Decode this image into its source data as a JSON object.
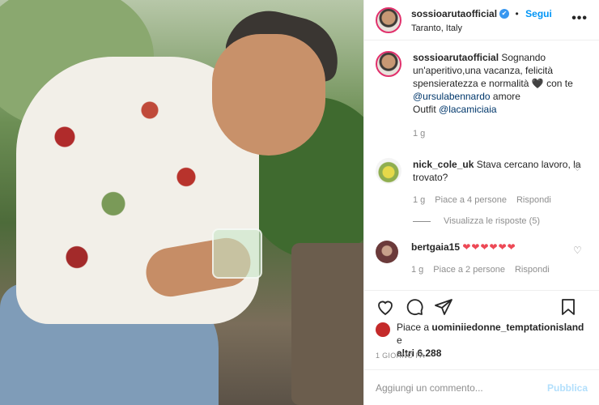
{
  "header": {
    "username": "sossioarutaofficial",
    "verified_mark": "✔",
    "separator": "•",
    "follow_label": "Segui",
    "location": "Taranto, Italy",
    "more_icon": "more-horizontal-icon"
  },
  "caption": {
    "username": "sossioarutaofficial",
    "text_part1": "Sognando un'aperitivo,una vacanza, felicità spensieratezza e normalità",
    "emoji": "🖤",
    "text_part2": "con te",
    "mention1": "@ursulabennardo",
    "text_part3": "amore",
    "outfit_label": "Outfit",
    "mention2": "@lacamiciaia",
    "time": "1 g"
  },
  "comments": [
    {
      "username": "nick_cole_uk",
      "text": "Stava cercano lavoro, la trovato?",
      "time": "1 g",
      "likes": "Piace a 4 persone",
      "reply": "Rispondi",
      "view_replies": "Visualizza le risposte (5)"
    },
    {
      "username": "bertgaia15",
      "text": "❤❤❤❤❤❤",
      "time": "1 g",
      "likes": "Piace a 2 persone",
      "reply": "Rispondi"
    }
  ],
  "likes": {
    "prefix": "Piace a",
    "user": "uominiiedonne_temptationisland",
    "connector": "e",
    "others": "altri 6.288"
  },
  "timestamp": "1 GIORNO FA",
  "add_comment": {
    "placeholder": "Aggiungi un commento...",
    "publish_label": "Pubblica"
  },
  "colors": {
    "link": "#0095f6",
    "heart": "#ed4956",
    "verified": "#3897f0"
  }
}
